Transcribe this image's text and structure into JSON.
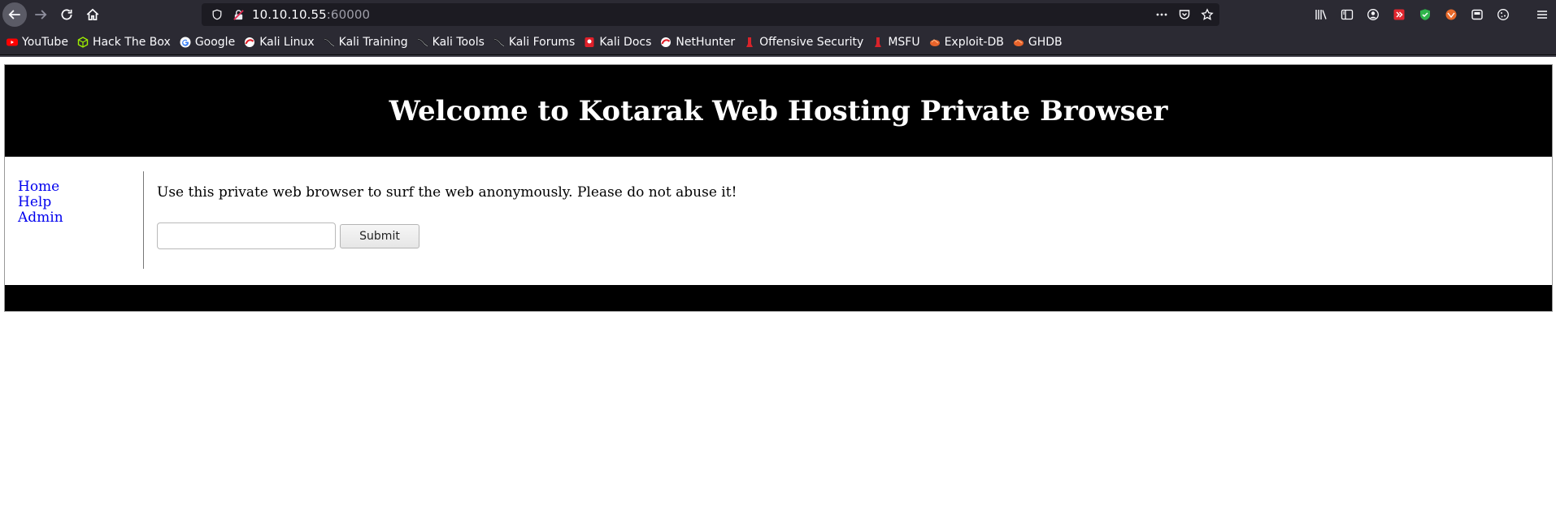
{
  "browser": {
    "url_host": "10.10.10.55",
    "url_port": ":60000",
    "bookmarks": [
      {
        "label": "YouTube",
        "icon": "youtube-icon"
      },
      {
        "label": "Hack The Box",
        "icon": "htb-cube-icon"
      },
      {
        "label": "Google",
        "icon": "google-icon"
      },
      {
        "label": "Kali Linux",
        "icon": "kali-icon"
      },
      {
        "label": "Kali Training",
        "icon": "kali-dragon-icon"
      },
      {
        "label": "Kali Tools",
        "icon": "kali-dragon-icon"
      },
      {
        "label": "Kali Forums",
        "icon": "kali-dragon-icon"
      },
      {
        "label": "Kali Docs",
        "icon": "kali-docs-icon"
      },
      {
        "label": "NetHunter",
        "icon": "nethunter-icon"
      },
      {
        "label": "Offensive Security",
        "icon": "offsec-icon"
      },
      {
        "label": "MSFU",
        "icon": "msfu-icon"
      },
      {
        "label": "Exploit-DB",
        "icon": "exploitdb-icon"
      },
      {
        "label": "GHDB",
        "icon": "ghdb-icon"
      }
    ]
  },
  "site": {
    "title": "Welcome to Kotarak Web Hosting Private Browser",
    "nav": [
      "Home",
      "Help",
      "Admin"
    ],
    "intro": "Use this private web browser to surf the web anonymously. Please do not abuse it!",
    "input_value": "",
    "submit_label": "Submit"
  },
  "colors": {
    "chrome_bg": "#2b2a33",
    "urlbar_bg": "#1c1b22",
    "header_bg": "#000000",
    "link": "#0000ee"
  }
}
